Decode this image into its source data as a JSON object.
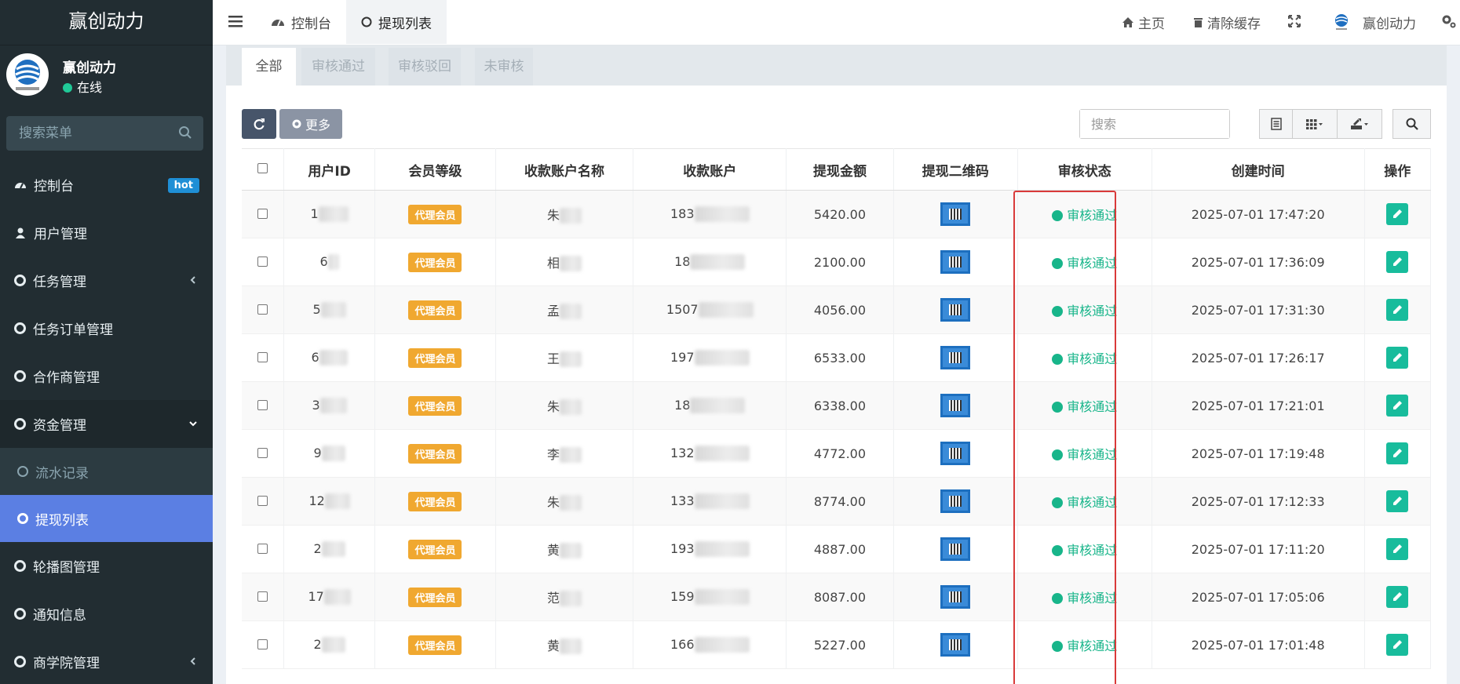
{
  "app": {
    "brand": "赢创动力"
  },
  "user": {
    "name": "赢创动力",
    "status": "在线"
  },
  "sidebar": {
    "search_placeholder": "搜索菜单",
    "items": [
      {
        "label": "控制台",
        "badge": "hot"
      },
      {
        "label": "用户管理"
      },
      {
        "label": "任务管理"
      },
      {
        "label": "任务订单管理"
      },
      {
        "label": "合作商管理"
      },
      {
        "label": "资金管理"
      },
      {
        "label": "流水记录"
      },
      {
        "label": "提现列表"
      },
      {
        "label": "轮播图管理"
      },
      {
        "label": "通知信息"
      },
      {
        "label": "商学院管理"
      }
    ]
  },
  "topbar": {
    "tabs": [
      {
        "label": "控制台"
      },
      {
        "label": "提现列表"
      }
    ],
    "home": "主页",
    "clear_cache": "清除缓存",
    "account": "赢创动力"
  },
  "filters": [
    "全部",
    "审核通过",
    "审核驳回",
    "未审核"
  ],
  "toolbar": {
    "more": "更多",
    "search_placeholder": "搜索"
  },
  "table": {
    "headers": [
      "用户ID",
      "会员等级",
      "收款账户名称",
      "收款账户",
      "提现金额",
      "提现二维码",
      "审核状态",
      "创建时间",
      "操作"
    ],
    "rows": [
      {
        "uid": "1",
        "level": "代理会员",
        "name": "朱",
        "account": "183",
        "amount": "5420.00",
        "status": "审核通过",
        "created": "2025-07-01 17:47:20"
      },
      {
        "uid": "6",
        "level": "代理会员",
        "name": "相",
        "account": "18",
        "amount": "2100.00",
        "status": "审核通过",
        "created": "2025-07-01 17:36:09"
      },
      {
        "uid": "5",
        "level": "代理会员",
        "name": "孟",
        "account": "1507",
        "amount": "4056.00",
        "status": "审核通过",
        "created": "2025-07-01 17:31:30"
      },
      {
        "uid": "6",
        "level": "代理会员",
        "name": "王",
        "account": "197",
        "amount": "6533.00",
        "status": "审核通过",
        "created": "2025-07-01 17:26:17"
      },
      {
        "uid": "3",
        "level": "代理会员",
        "name": "朱",
        "account": "18",
        "amount": "6338.00",
        "status": "审核通过",
        "created": "2025-07-01 17:21:01"
      },
      {
        "uid": "9",
        "level": "代理会员",
        "name": "李",
        "account": "132",
        "amount": "4772.00",
        "status": "审核通过",
        "created": "2025-07-01 17:19:48"
      },
      {
        "uid": "12",
        "level": "代理会员",
        "name": "朱",
        "account": "133",
        "amount": "8774.00",
        "status": "审核通过",
        "created": "2025-07-01 17:12:33"
      },
      {
        "uid": "2",
        "level": "代理会员",
        "name": "黄",
        "account": "193",
        "amount": "4887.00",
        "status": "审核通过",
        "created": "2025-07-01 17:11:20"
      },
      {
        "uid": "17",
        "level": "代理会员",
        "name": "范",
        "account": "159",
        "amount": "8087.00",
        "status": "审核通过",
        "created": "2025-07-01 17:05:06"
      },
      {
        "uid": "2",
        "level": "代理会员",
        "name": "黄",
        "account": "166",
        "amount": "5227.00",
        "status": "审核通过",
        "created": "2025-07-01 17:01:48"
      }
    ]
  },
  "colors": {
    "sidebar_bg": "#222d32",
    "active_item": "#5b7fe3",
    "status_ok": "#18b58a",
    "level_badge": "#f0a830",
    "highlight": "#d93a3a"
  }
}
